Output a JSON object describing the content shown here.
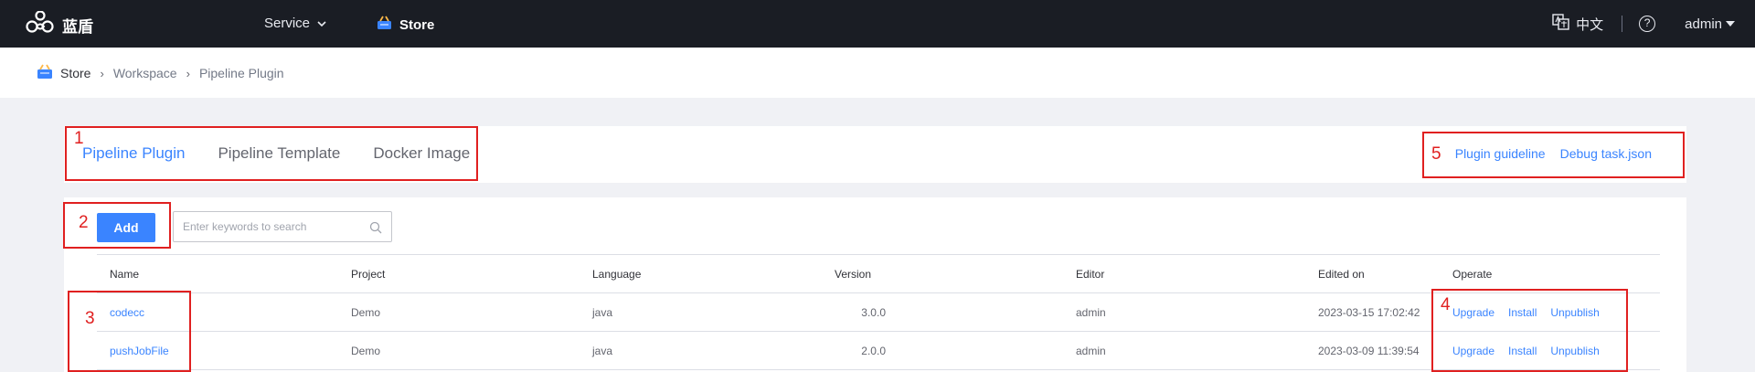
{
  "topnav": {
    "brand": "蓝盾",
    "service_label": "Service",
    "store_label": "Store",
    "lang_label": "中文",
    "help_label": "?",
    "user_label": "admin"
  },
  "breadcrumb": {
    "home": "Store",
    "items": [
      "Workspace",
      "Pipeline Plugin"
    ]
  },
  "tabs": [
    {
      "label": "Pipeline Plugin",
      "active": true
    },
    {
      "label": "Pipeline Template",
      "active": false
    },
    {
      "label": "Docker Image",
      "active": false
    }
  ],
  "links": {
    "guideline": "Plugin guideline",
    "debug": "Debug task.json"
  },
  "toolbar": {
    "add_label": "Add",
    "search_placeholder": "Enter keywords to search"
  },
  "table": {
    "columns": [
      "Name",
      "Project",
      "Language",
      "Version",
      "Editor",
      "Edited on",
      "Operate"
    ],
    "rows": [
      {
        "name": "codecc",
        "project": "Demo",
        "language": "java",
        "version": "3.0.0",
        "editor": "admin",
        "edited_on": "2023-03-15 17:02:42",
        "ops": [
          "Upgrade",
          "Install",
          "Unpublish"
        ]
      },
      {
        "name": "pushJobFile",
        "project": "Demo",
        "language": "java",
        "version": "2.0.0",
        "editor": "admin",
        "edited_on": "2023-03-09 11:39:54",
        "ops": [
          "Upgrade",
          "Install",
          "Unpublish"
        ]
      }
    ]
  },
  "annotations": [
    "1",
    "2",
    "3",
    "4",
    "5"
  ],
  "colors": {
    "nav_bg": "#1a1d24",
    "accent": "#3a84ff",
    "annotation": "#e02020"
  }
}
